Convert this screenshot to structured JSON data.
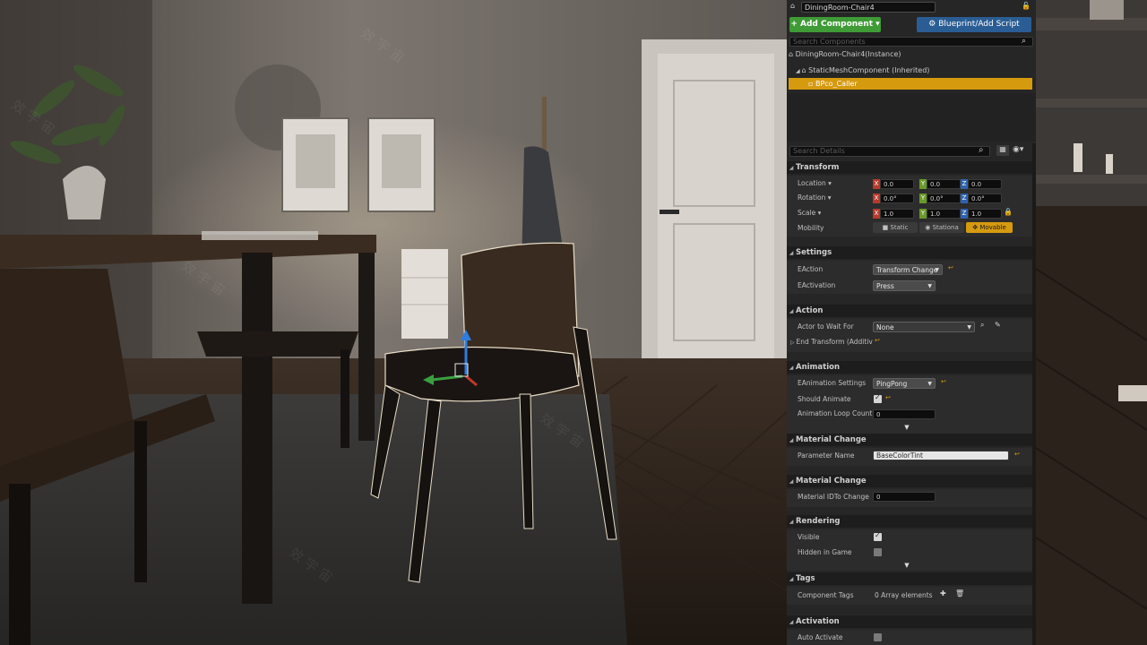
{
  "header": {
    "actor_name": "DiningRoom-Chair4",
    "add_component_label": "+ Add Component",
    "blueprint_label": "Blueprint/Add Script",
    "search_components_placeholder": "Search Components"
  },
  "components": {
    "root_label": "DiningRoom-Chair4(Instance)",
    "items": [
      {
        "label": "StaticMeshComponent (Inherited)",
        "icon": "mesh-icon"
      },
      {
        "label": "BPco_Caller",
        "icon": "component-icon",
        "selected": true
      }
    ]
  },
  "details": {
    "search_placeholder": "Search Details",
    "transform": {
      "title": "Transform",
      "location_label": "Location",
      "rotation_label": "Rotation",
      "scale_label": "Scale",
      "mobility_label": "Mobility",
      "location": {
        "x": "0.0",
        "y": "0.0",
        "z": "0.0"
      },
      "rotation": {
        "x": "0.0°",
        "y": "0.0°",
        "z": "0.0°"
      },
      "scale": {
        "x": "1.0",
        "y": "1.0",
        "z": "1.0"
      },
      "mobility_options": [
        "Static",
        "Stationa",
        "Movable"
      ],
      "mobility_selected": "Movable"
    },
    "settings": {
      "title": "Settings",
      "eaction_label": "EAction",
      "eaction_value": "Transform Change",
      "eactivation_label": "EActivation",
      "eactivation_value": "Press"
    },
    "action": {
      "title": "Action",
      "actor_wait_label": "Actor to Wait For",
      "actor_wait_value": "None",
      "end_transform_label": "End Transform (Additiv"
    },
    "animation": {
      "title": "Animation",
      "settings_label": "EAnimation Settings",
      "settings_value": "PingPong",
      "should_animate_label": "Should Animate",
      "loop_count_label": "Animation Loop Count (",
      "loop_count_value": "0"
    },
    "material_change_1": {
      "title": "Material Change",
      "param_label": "Parameter Name",
      "param_value": "BaseColorTint"
    },
    "material_change_2": {
      "title": "Material Change",
      "id_label": "Material IDTo Change",
      "id_value": "0"
    },
    "rendering": {
      "title": "Rendering",
      "visible_label": "Visible",
      "hidden_label": "Hidden in Game"
    },
    "tags": {
      "title": "Tags",
      "component_tags_label": "Component Tags",
      "component_tags_value": "0 Array elements"
    },
    "activation": {
      "title": "Activation",
      "auto_activate_label": "Auto Activate"
    }
  },
  "colors": {
    "accent": "#d69a0f",
    "add_button": "#3f9b35",
    "blueprint_button": "#2a5d94",
    "panel_bg": "#262626"
  }
}
